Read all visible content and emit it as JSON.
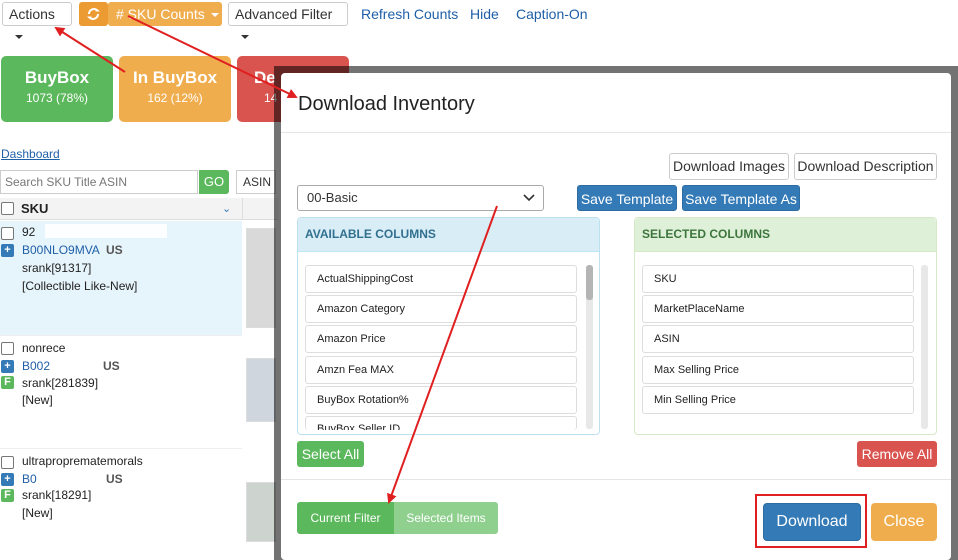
{
  "toolbar": {
    "actions_label": "Actions",
    "sku_counts_label": "# SKU Counts",
    "advanced_filter_label": "Advanced Filter",
    "refresh_counts": "Refresh Counts",
    "hide": "Hide",
    "caption_on": "Caption-On"
  },
  "tiles": [
    {
      "title": "BuyBox",
      "sub": "1073 (78%)",
      "color": "#5cb85c"
    },
    {
      "title": "In BuyBox",
      "sub": "162 (12%)",
      "color": "#f0ad4e"
    },
    {
      "title": "De",
      "sub": "14",
      "color": "#d9534f"
    }
  ],
  "left": {
    "dashboard_link": "Dashboard",
    "search_placeholder": "Search SKU Title ASIN",
    "go_label": "GO",
    "asin_select": "ASIN",
    "column_header": "SKU",
    "rows": [
      {
        "sku": "92",
        "asin": "B00NLO9MVA",
        "market": "US",
        "rank": "srank[91317]",
        "condition": "[Collectible Like-New]",
        "badge": "+"
      },
      {
        "sku": "nonrece",
        "asin": "B002",
        "market": "US",
        "rank": "srank[281839]",
        "condition": "[New]",
        "badge": "F"
      },
      {
        "sku": "ultraproprematemorals",
        "asin": "B0",
        "market": "US",
        "rank": "srank[18291]",
        "condition": "[New]",
        "badge": "F"
      }
    ]
  },
  "modal": {
    "title": "Download Inventory",
    "download_images": "Download Images",
    "download_description": "Download Description",
    "template_value": "00-Basic",
    "save_template": "Save Template",
    "save_template_as": "Save Template As",
    "available_header": "AVAILABLE COLUMNS",
    "selected_header": "SELECTED COLUMNS",
    "available_columns": [
      "ActualShippingCost",
      "Amazon Category",
      "Amazon Price",
      "Amzn Fea MAX",
      "BuyBox Rotation%",
      "BuyBox Seller ID"
    ],
    "selected_columns": [
      "SKU",
      "MarketPlaceName",
      "ASIN",
      "Max Selling Price",
      "Min Selling Price"
    ],
    "select_all": "Select All",
    "remove_all": "Remove All",
    "current_filter": "Current Filter",
    "selected_items": "Selected Items",
    "download": "Download",
    "close": "Close"
  },
  "colors": {
    "primary": "#337ab7",
    "success": "#5cb85c",
    "warning": "#f0ad4e",
    "danger": "#d9534f",
    "annotation": "#e02020"
  }
}
